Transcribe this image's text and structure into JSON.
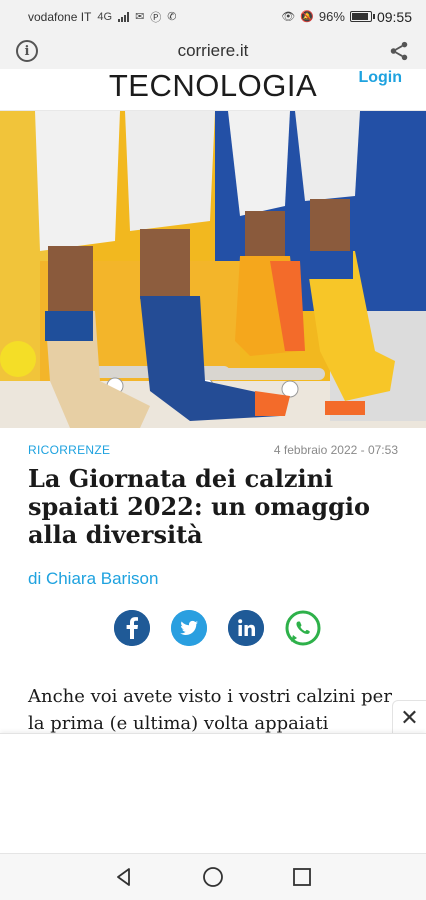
{
  "status_bar": {
    "carrier": "vodafone IT",
    "network": "4G",
    "battery_text": "96%",
    "battery_level": 0.96,
    "time": "09:55"
  },
  "browser": {
    "url": "corriere.it",
    "info_icon": "info-icon",
    "share_icon": "share-icon"
  },
  "site_header": {
    "section": "TECNOLOGIA",
    "login": "Login"
  },
  "hero_image": {
    "description_icon": "photo"
  },
  "article": {
    "category": "RICORRENZE",
    "date": "4 febbraio 2022 - 07:53",
    "title": "La Giornata dei calzini spaiati 2022: un omaggio alla diversità",
    "author": "di Chiara Barison",
    "share": [
      {
        "name": "facebook-icon",
        "glyph": "f"
      },
      {
        "name": "twitter-icon",
        "glyph": "🐦"
      },
      {
        "name": "linkedin-icon",
        "glyph": "in"
      },
      {
        "name": "whatsapp-icon",
        "glyph": "✆"
      }
    ],
    "body_preview": "Anche voi avete visto i vostri calzini per la prima (e ultima) volta appaiati"
  },
  "ad": {
    "close_glyph": "✕"
  },
  "colors": {
    "accent": "#1ea2df",
    "social": "#1f5a97"
  }
}
